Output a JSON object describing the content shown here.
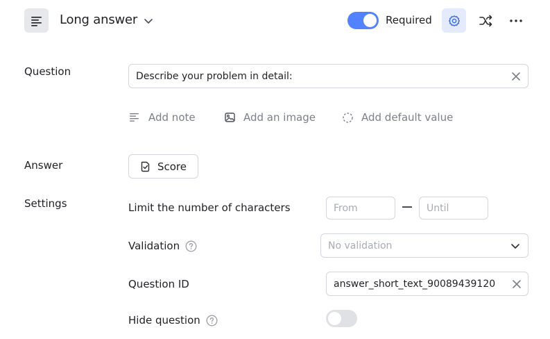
{
  "header": {
    "type_icon": "align-left-icon",
    "type_title": "Long answer",
    "required_label": "Required",
    "required_on": true,
    "accent_color": "#5282ff",
    "icons": [
      "align-left-icon",
      "chevron-down-icon",
      "gear-icon",
      "shuffle-icon",
      "more-horizontal-icon"
    ]
  },
  "question": {
    "label": "Question",
    "value": "Describe your problem in detail:",
    "actions": {
      "add_note": "Add note",
      "add_image": "Add an image",
      "add_default": "Add default value"
    }
  },
  "answer": {
    "label": "Answer",
    "score_label": "Score"
  },
  "settings": {
    "label": "Settings",
    "limit_label": "Limit the number of characters",
    "from_placeholder": "From",
    "until_placeholder": "Until",
    "validation_label": "Validation",
    "validation_value": "No validation",
    "question_id_label": "Question ID",
    "question_id_value": "answer_short_text_90089439120",
    "hide_question_label": "Hide question",
    "hide_question_on": false
  }
}
